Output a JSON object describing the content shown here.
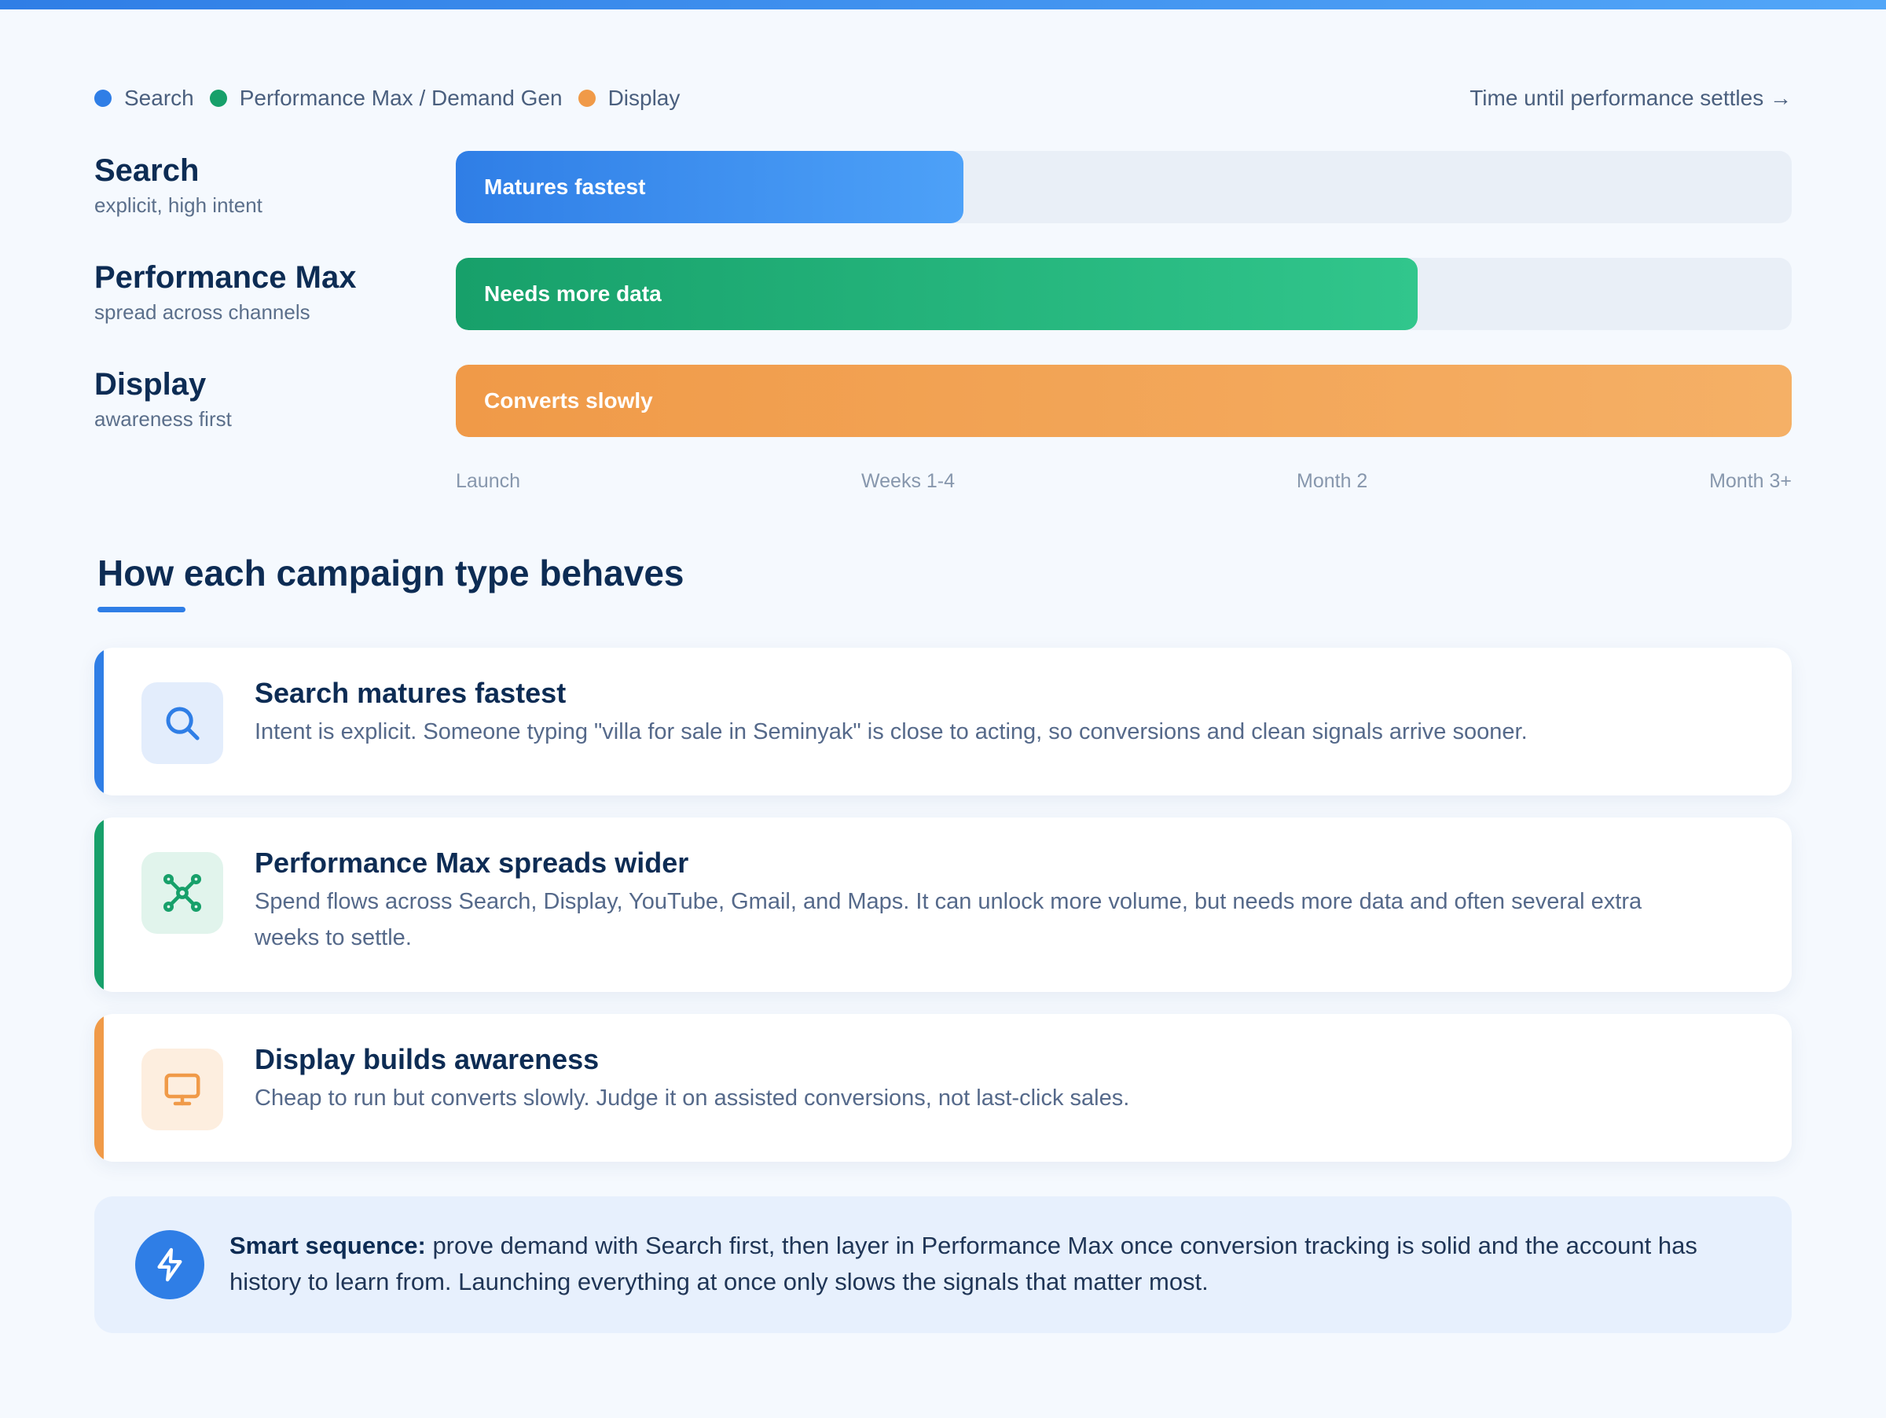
{
  "colors": {
    "search": "#2f7ee6",
    "pmax": "#17a06a",
    "display": "#f09a48",
    "track": "#e9eff7",
    "navy": "#0d2c54"
  },
  "legend": {
    "items": [
      {
        "label": "Search",
        "color": "#2f7ee6"
      },
      {
        "label": "Performance Max / Demand Gen",
        "color": "#17a06a"
      },
      {
        "label": "Display",
        "color": "#f09a48"
      }
    ],
    "time_note": "Time until performance settles →"
  },
  "timeline": {
    "rows": [
      {
        "title": "Search",
        "subtitle": "explicit, high intent",
        "bar_label": "Matures fastest",
        "fill_fraction": 0.38
      },
      {
        "title": "Performance Max",
        "subtitle": "spread across channels",
        "bar_label": "Needs more data",
        "fill_fraction": 0.72
      },
      {
        "title": "Display",
        "subtitle": "awareness first",
        "bar_label": "Converts slowly",
        "fill_fraction": 1.0
      }
    ],
    "axis_ticks": [
      "Launch",
      "Weeks 1-4",
      "Month 2",
      "Month 3+"
    ]
  },
  "section": {
    "title": "How each campaign type behaves"
  },
  "cards": [
    {
      "icon": "search-icon",
      "title": "Search matures fastest",
      "text": "Intent is explicit. Someone typing \"villa for sale in Seminyak\" is close to acting, so conversions and clean signals arrive sooner."
    },
    {
      "icon": "network-icon",
      "title": "Performance Max spreads wider",
      "text": "Spend flows across Search, Display, YouTube, Gmail, and Maps. It can unlock more volume, but needs more data and often several extra weeks to settle."
    },
    {
      "icon": "monitor-icon",
      "title": "Display builds awareness",
      "text": "Cheap to run but converts slowly. Judge it on assisted conversions, not last-click sales."
    }
  ],
  "callout": {
    "icon": "lightning-icon",
    "strong": "Smart sequence:",
    "text": " prove demand with Search first, then layer in Performance Max once conversion tracking is solid and the account has history to learn from. Launching everything at once only slows the signals that matter most."
  }
}
